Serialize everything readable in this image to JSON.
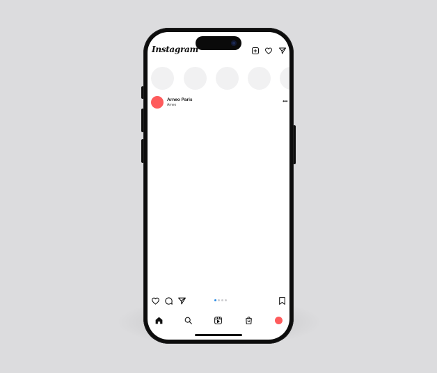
{
  "app": {
    "logo_text": "Instagram"
  },
  "header": {
    "icons": [
      "add-post-icon",
      "heart-icon",
      "send-icon"
    ]
  },
  "stories": {
    "count": 5,
    "color": "#f1f1f2"
  },
  "post": {
    "account_name": "Arneo Paris",
    "account_sub": "Arneo",
    "more_label": "•••",
    "avatar_color": "#fe5b5c",
    "carousel": {
      "total": 4,
      "active_index": 0,
      "active_color": "#2f8ee6",
      "inactive_color": "#cdcdd0"
    },
    "action_icons": [
      "heart-icon",
      "comment-icon",
      "send-icon",
      "bookmark-icon"
    ]
  },
  "tabbar": {
    "items": [
      "home-icon",
      "search-icon",
      "reels-icon",
      "shop-icon",
      "profile-avatar"
    ],
    "profile_color": "#fe5b5c"
  },
  "colors": {
    "background": "#dcdcde",
    "phone_frame": "#0d0d0d",
    "screen": "#ffffff"
  }
}
